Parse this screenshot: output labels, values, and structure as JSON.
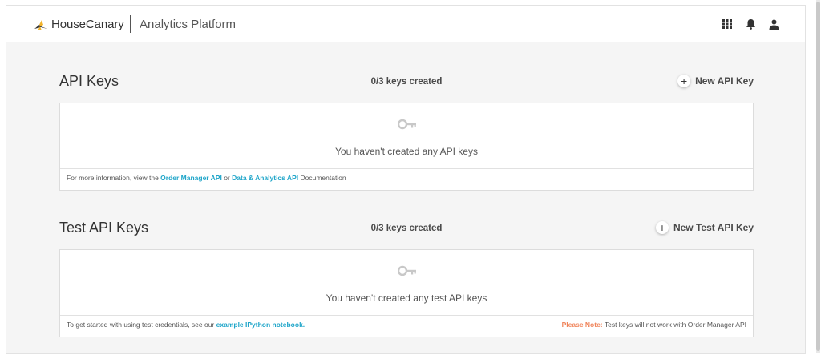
{
  "header": {
    "brand": "HouseCanary",
    "product": "Analytics Platform",
    "icons": [
      "apps-grid-icon",
      "bell-icon",
      "user-icon"
    ]
  },
  "api_keys": {
    "title": "API Keys",
    "count": "0/3 keys created",
    "new_button": "New API Key",
    "empty_message": "You haven't created any API keys",
    "footer": {
      "prefix": "For more information, view the ",
      "link1": "Order Manager API",
      "middle": " or ",
      "link2": "Data & Analytics API",
      "suffix": " Documentation"
    }
  },
  "test_keys": {
    "title": "Test API Keys",
    "count": "0/3 keys created",
    "new_button": "New Test API Key",
    "empty_message": "You haven't created any test API keys",
    "footer": {
      "prefix": "To get started with using test credentials, see our ",
      "link": "example IPython notebook.",
      "note_label": "Please Note:",
      "note_text": " Test keys will not work with Order Manager API"
    }
  },
  "colors": {
    "link": "#1ea5c9",
    "note": "#f0845a",
    "brand_mark": "#f2b32a"
  }
}
